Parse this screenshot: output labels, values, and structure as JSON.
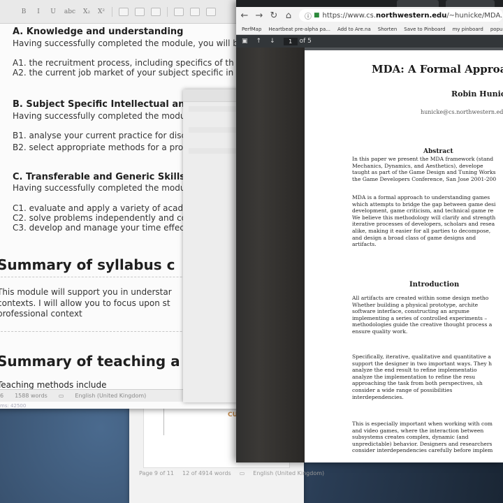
{
  "word_doc": {
    "toolbar": [
      "B",
      "I",
      "U",
      "abc",
      "X₂",
      "X²"
    ],
    "sections": {
      "a_heading": "A. Knowledge and understanding",
      "a_sub": "Having successfully completed the module, you will b",
      "a1": "A1. the recruitment process, including specifics of th",
      "a2": "A2. the current job market of your subject specific in",
      "b_heading": "B. Subject Specific Intellectual and R",
      "b_sub": "Having successfully completed the modul",
      "b1": "B1. analyse your current practice for disci",
      "b2": "B2. select appropriate methods for a prof",
      "c_heading": "C. Transferable and Generic Skills",
      "c_sub": "Having successfully completed the modul",
      "c1": "C1. evaluate and apply a variety of acader",
      "c2": "C2. solve problems independently and col",
      "c3": "C3. develop and manage your time effecti",
      "syllabus_heading": "Summary of syllabus c",
      "syllabus_p1": "This module will support you in understar",
      "syllabus_p2": "contexts. I will allow you to focus upon st",
      "syllabus_p3": "professional context",
      "teaching_heading": "Summary of teaching a",
      "teaching_methods": "Teaching methods include"
    },
    "status": {
      "page": "6",
      "words": "1588 words",
      "language": "English (United Kingdom)"
    },
    "below_status": "ms: 42500"
  },
  "word_doc2": {
    "stamp": "CUA",
    "status": {
      "page": "Page 9 of 11",
      "words": "12 of 4914 words",
      "language": "English (United Kingdom)"
    }
  },
  "browser": {
    "url_host": "https://www.cs.",
    "url_domain": "northwestern.edu",
    "url_path": "/~hunicke/MDA.pdf",
    "bookmarks": [
      "PerfMap",
      "Heartbeat pre-alpha pa...",
      "Add to Are.na",
      "Shorten",
      "Save to Pinboard",
      "my pinboard",
      "popup w"
    ],
    "page_current": "1",
    "page_total": "of 5"
  },
  "pdf": {
    "title": "MDA: A Formal Approa",
    "author": "Robin Hunic",
    "email": "hunicke@cs.northwestern.edu",
    "abstract_heading": "Abstract",
    "abstract_lines": [
      "In this paper we present the MDA framework (stand",
      "Mechanics, Dynamics, and Aesthetics), develope",
      "taught as part of the Game Design and Tuning Works",
      "the Game Developers Conference, San Jose 2001-200"
    ],
    "abstract_lines2": [
      "MDA is a formal approach to understanding games",
      "which attempts to bridge the gap between game desi",
      "development, game criticism, and technical game re",
      "We believe this methodology will clarify and strength",
      "iterative processes of developers, scholars and resea",
      "alike, making it easier for all parties to decompose,",
      "and design a broad class of game designs and",
      "artifacts."
    ],
    "intro_heading": "Introduction",
    "intro_p1": [
      "All artifacts are created within some design metho",
      "Whether building a physical prototype, archite",
      "software interface, constructing an argume",
      "implementing a series of controlled experiments –",
      "methodologies guide the creative thought process a",
      "ensure quality work."
    ],
    "intro_p2": [
      "Specifically, iterative, qualitative and quantitative a",
      "support the designer in two important ways. They h",
      "analyze the end result to refine implementatio",
      "analyze the implementation to refine the resu",
      "approaching the task from both perspectives, sh",
      "consider a wide range of possibilities",
      "interdependencies."
    ],
    "intro_p3": [
      "This is especially important when working with com",
      "and video games, where the interaction between",
      "subsystems creates complex, dynamic (and",
      "unpredictable) behavior. Designers and researchers",
      "consider interdependencies carefully before implem"
    ]
  }
}
